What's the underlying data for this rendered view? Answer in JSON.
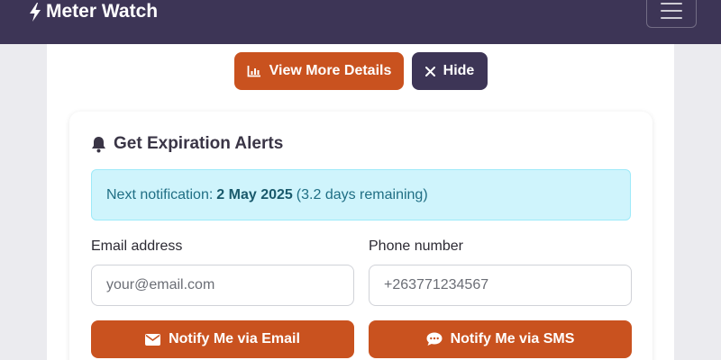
{
  "navbar": {
    "brand": "Meter Watch",
    "brand_icon": "lightning-bolt-icon",
    "menu_icon": "hamburger-menu-icon"
  },
  "actions": {
    "details_label": "View More Details",
    "details_icon": "bar-chart-icon",
    "hide_label": "Hide",
    "hide_icon": "close-x-icon"
  },
  "alerts": {
    "title": "Get Expiration Alerts",
    "title_icon": "bell-icon",
    "notification_prefix": "Next notification:",
    "notification_date": "2 May 2025",
    "notification_remaining": "(3.2 days remaining)",
    "email": {
      "label": "Email address",
      "placeholder": "your@email.com",
      "button_label": "Notify Me via Email",
      "button_icon": "envelope-icon"
    },
    "phone": {
      "label": "Phone number",
      "placeholder": "+263771234567",
      "button_label": "Notify Me via SMS",
      "button_icon": "chat-bubble-icon"
    }
  },
  "colors": {
    "navbar_bg": "#3d3556",
    "accent_orange": "#c9521f",
    "info_bg": "#cff4fc",
    "info_text": "#1f6e84"
  }
}
